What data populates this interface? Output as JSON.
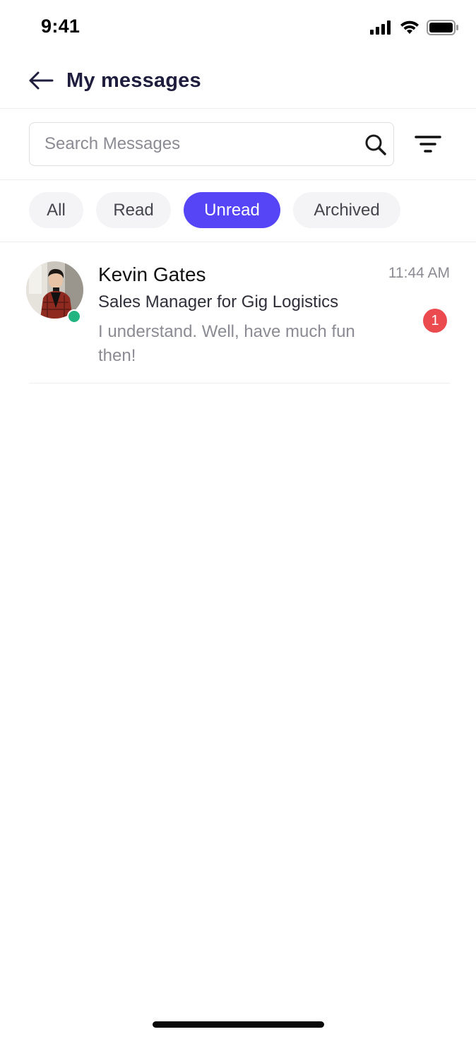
{
  "status_bar": {
    "time": "9:41",
    "icons": [
      "cellular-signal-icon",
      "wifi-icon",
      "battery-icon"
    ]
  },
  "header": {
    "back_icon": "arrow-left-icon",
    "title": "My messages"
  },
  "search": {
    "placeholder": "Search Messages",
    "value": "",
    "search_icon": "search-icon",
    "filter_icon": "filter-icon"
  },
  "tabs": [
    {
      "label": "All",
      "active": false
    },
    {
      "label": "Read",
      "active": false
    },
    {
      "label": "Unread",
      "active": true
    },
    {
      "label": "Archived",
      "active": false
    }
  ],
  "messages": [
    {
      "name": "Kevin Gates",
      "role": "Sales Manager for Gig Logistics",
      "preview": "I understand. Well, have much fun then!",
      "time": "11:44 AM",
      "unread_count": "1",
      "online": true
    }
  ],
  "colors": {
    "accent": "#5545f6",
    "online": "#22b582",
    "badge": "#eb4a4f",
    "title": "#1f1d3d"
  }
}
